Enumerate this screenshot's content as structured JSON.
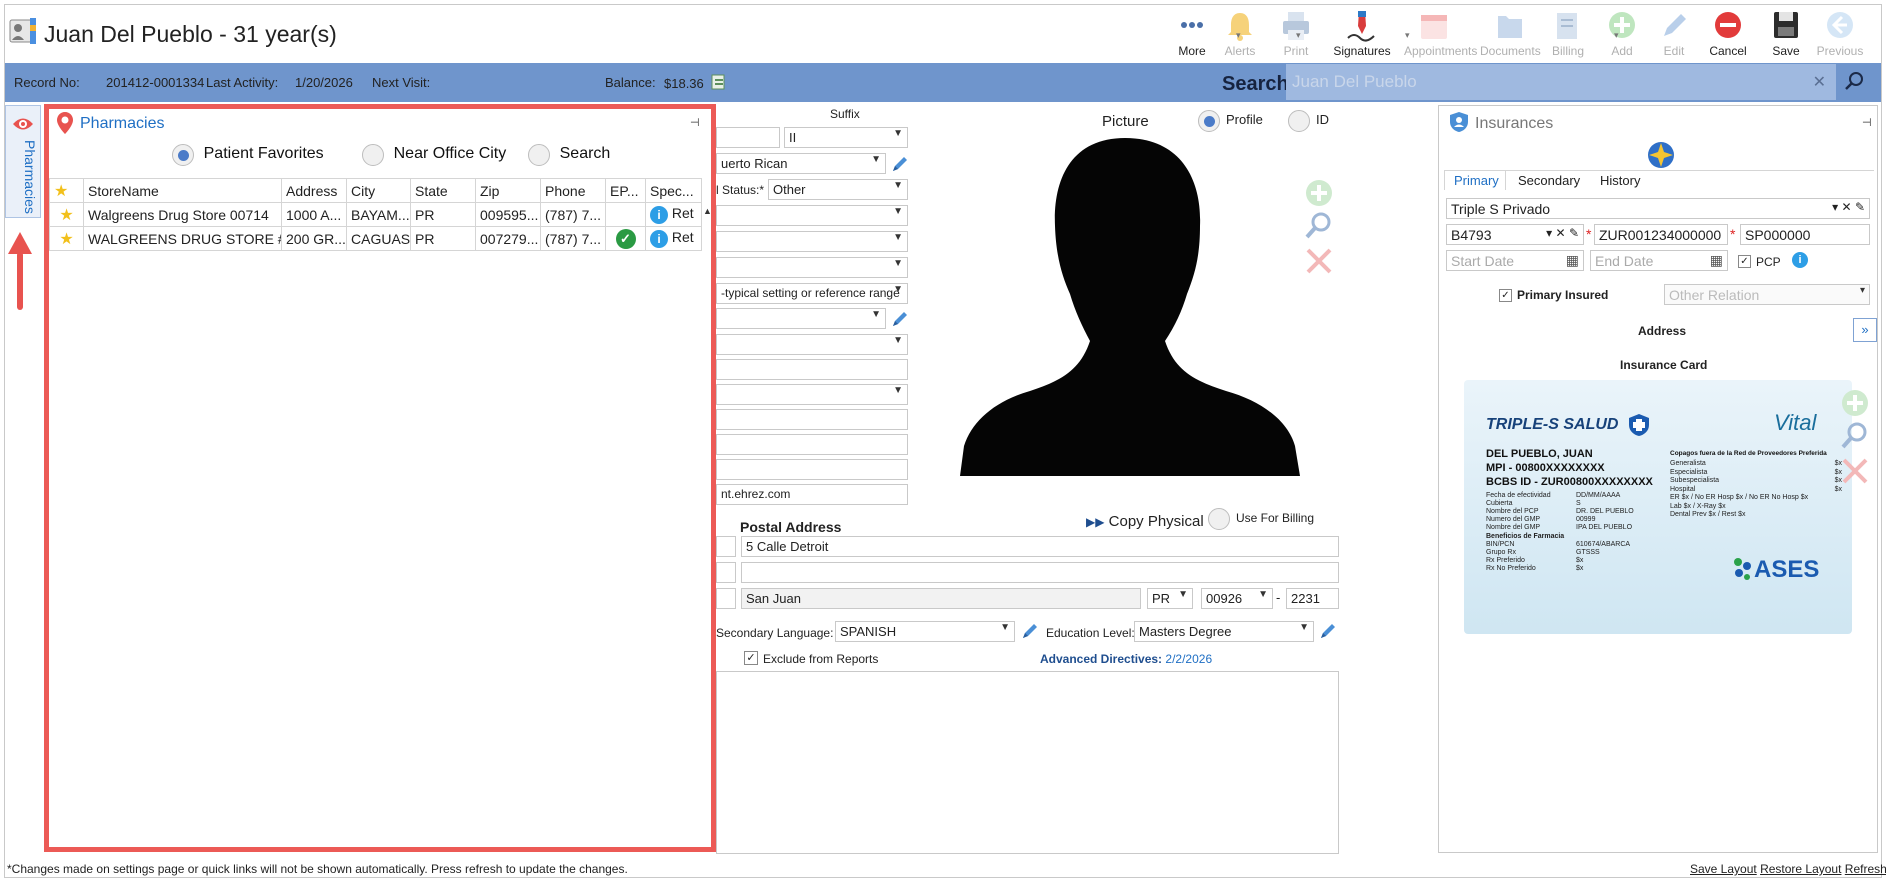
{
  "window": {
    "title": "Juan Del Pueblo - 31 year(s)"
  },
  "toolbar": {
    "buttons": [
      {
        "label": "More",
        "icon": "more-dots-icon",
        "enabled": true
      },
      {
        "label": "Alerts",
        "icon": "bell-icon",
        "enabled": false
      },
      {
        "label": "Print",
        "icon": "printer-icon",
        "enabled": false
      },
      {
        "label": "Signatures",
        "icon": "signature-pen-icon",
        "enabled": true
      },
      {
        "label": "Appointments",
        "icon": "calendar-icon",
        "enabled": false
      },
      {
        "label": "Documents",
        "icon": "documents-icon",
        "enabled": false
      },
      {
        "label": "Billing",
        "icon": "billing-icon",
        "enabled": false
      },
      {
        "label": "Add",
        "icon": "add-icon",
        "enabled": false
      },
      {
        "label": "Edit",
        "icon": "edit-pencil-icon",
        "enabled": false
      },
      {
        "label": "Cancel",
        "icon": "cancel-icon",
        "enabled": true
      },
      {
        "label": "Save",
        "icon": "save-disk-icon",
        "enabled": true
      },
      {
        "label": "Previous",
        "icon": "previous-arrow-icon",
        "enabled": false
      }
    ]
  },
  "record_bar": {
    "record_label": "Record No:",
    "record_value": "201412-0001334",
    "activity_label": "Last Activity:",
    "activity_value": "1/20/2026",
    "visit_label": "Next Visit:",
    "visit_value": "",
    "balance_label": "Balance:",
    "balance_value": "$18.36",
    "search_label": "Search:",
    "search_placeholder": "Juan Del Pueblo"
  },
  "side_tab": {
    "label": "Pharmacies"
  },
  "pharmacies": {
    "title": "Pharmacies",
    "filters": [
      {
        "label": "Patient Favorites",
        "selected": true
      },
      {
        "label": "Near Office City",
        "selected": false
      },
      {
        "label": "Search",
        "selected": false
      }
    ],
    "columns": [
      "StoreName",
      "Address",
      "City",
      "State",
      "Zip",
      "Phone",
      "EP...",
      "Spec..."
    ],
    "rows": [
      {
        "store": "Walgreens Drug Store 00714",
        "address": "1000 A...",
        "city": "BAYAM...",
        "state": "PR",
        "zip": "009595...",
        "phone": "(787) 7...",
        "ep": false,
        "spec": "Ret"
      },
      {
        "store": "WALGREENS DRUG STORE #...",
        "address": "200 GR...",
        "city": "CAGUAS",
        "state": "PR",
        "zip": "007279...",
        "phone": "(787) 7...",
        "ep": true,
        "spec": "Ret"
      }
    ]
  },
  "demographics": {
    "suffix_label": "Suffix",
    "suffix_value": "II",
    "ethnicity_value": "uerto Rican",
    "status_label": "l Status:*",
    "status_value": "Other",
    "reference_value": "-typical setting or reference range",
    "email_value": "nt.ehrez.com",
    "picture_label": "Picture",
    "picture_options": [
      {
        "label": "Profile",
        "selected": true
      },
      {
        "label": "ID",
        "selected": false
      }
    ]
  },
  "postal": {
    "title": "Postal Address",
    "copy_label": "Copy Physical",
    "use_billing_label": "Use For Billing",
    "line1": "5 Calle Detroit",
    "line2": "",
    "city": "San Juan",
    "state": "PR",
    "zip": "00926",
    "zip_ext": "2231",
    "zip_sep": "-"
  },
  "extra": {
    "secondary_language_label": "Secondary Language:",
    "secondary_language_value": "SPANISH",
    "education_label": "Education Level:",
    "education_value": "Masters Degree",
    "exclude_label": "Exclude from Reports",
    "advanced_label": "Advanced Directives:",
    "advanced_value": "2/2/2026"
  },
  "insurance": {
    "title": "Insurances",
    "tabs": [
      "Primary",
      "Secondary",
      "History"
    ],
    "plan": "Triple S Privado",
    "group_code": "B4793",
    "member_id": "ZUR001234000000",
    "subscriber": "SP000000",
    "start_placeholder": "Start Date",
    "end_placeholder": "End Date",
    "pcp_label": "PCP",
    "primary_insured_label": "Primary Insured",
    "other_relation_placeholder": "Other Relation",
    "address_label": "Address",
    "card_label": "Insurance Card",
    "card": {
      "brand": "TRIPLE-S SALUD",
      "partner": "Vital",
      "name": "DEL PUEBLO, JUAN",
      "mpi": "MPI - 00800XXXXXXXX",
      "bcbs": "BCBS ID - ZUR00800XXXXXXXX",
      "left_rows": [
        [
          "Fecha de efectividad",
          "DD/MM/AAAA"
        ],
        [
          "Cubierta",
          "S"
        ],
        [
          "Nombre del PCP",
          "DR. DEL PUEBLO"
        ],
        [
          "Numero del GMP",
          "00999"
        ],
        [
          "Nombre del GMP",
          "IPA DEL PUEBLO"
        ]
      ],
      "pharmacy_heading": "Beneficios de Farmacia",
      "pharmacy_rows": [
        [
          "BIN/PCN",
          "610674/ABARCA"
        ],
        [
          "Grupo Rx",
          "GTSSS"
        ],
        [
          "Rx Preferido",
          "$x"
        ],
        [
          "Rx No Preferido",
          "$x"
        ]
      ],
      "copay_heading": "Copagos fuera de la Red de Proveedores Preferida",
      "copay_rows": [
        [
          "Generalista",
          "$x"
        ],
        [
          "Especialista",
          "$x"
        ],
        [
          "Subespecialista",
          "$x"
        ],
        [
          "Hospital",
          "$x"
        ],
        [
          "ER $x / No ER Hosp $x / No ER No Hosp $x",
          ""
        ],
        [
          "Lab $x / X-Ray $x",
          ""
        ],
        [
          "Dental Prev $x / Rest $x",
          ""
        ]
      ],
      "ases": "ASES"
    }
  },
  "footer": {
    "note": "*Changes made on settings page or quick links will not be shown automatically. Press refresh to update the changes.",
    "links": [
      "Save Layout",
      "Restore Layout",
      "Refresh"
    ]
  },
  "colors": {
    "accent": "#6f95cc",
    "highlight": "#ec5a56",
    "link": "#1f6fc4"
  }
}
